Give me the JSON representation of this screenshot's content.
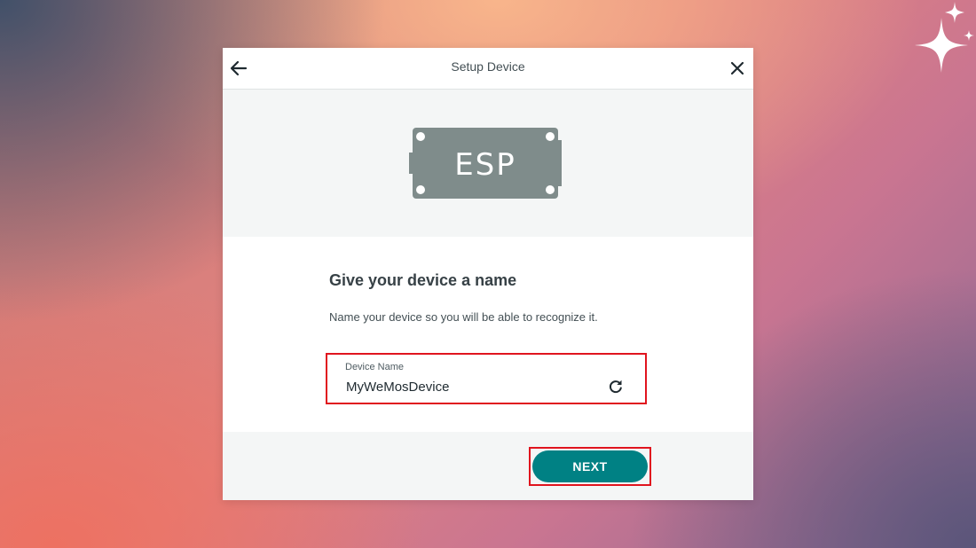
{
  "dialog": {
    "title": "Setup Device",
    "back_icon": "arrow-left-icon",
    "close_icon": "close-icon"
  },
  "hero": {
    "board_label": "ESP",
    "board_color": "#7f8c8b"
  },
  "content": {
    "heading": "Give your device a name",
    "subtext": "Name your device so you will be able to recognize it."
  },
  "device_name_field": {
    "label": "Device Name",
    "value": "MyWeMosDevice",
    "action_icon": "refresh-icon"
  },
  "footer": {
    "next_label": "NEXT"
  },
  "colors": {
    "accent": "#008184",
    "highlight": "#e0141e"
  }
}
